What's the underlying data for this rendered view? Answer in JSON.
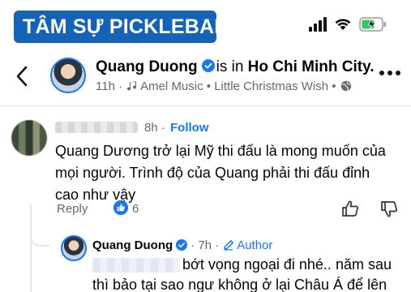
{
  "brand": {
    "logo_text": "TÂM SỰ PICKLEBALL"
  },
  "status_bar": {
    "signal_icon": "cellular-signal-icon",
    "wifi_icon": "wifi-icon",
    "battery_icon": "battery-charging-icon",
    "battery_color": "#34c759"
  },
  "post": {
    "author": "Quang Duong",
    "location_prefix": "is in",
    "location": "Ho Chi Minh City.",
    "time": "11h",
    "separator": "·",
    "music_artist": "Amel Music",
    "music_song": "Little Christmas Wish",
    "bullet": "•"
  },
  "comments": [
    {
      "time": "8h",
      "separator": "·",
      "follow_label": "Follow",
      "text": "Quang Dương trở lại Mỹ thi đấu là mong muốn của mọi người. Trình độ của Quang phải thi đấu đỉnh cao như vậy",
      "reply_label": "Reply",
      "reaction_count": "6"
    }
  ],
  "reply": {
    "author": "Quang Duong",
    "time": "7h",
    "separator": "·",
    "author_badge": "Author",
    "text_line1": "bớt vọng ngoại đi nhé.. năm sau",
    "text_line2": "thì bảo tại sao ngư không ở lại Châu Á để lên"
  },
  "colors": {
    "accent": "#1877f2",
    "brand": "#1463b8",
    "muted_text": "#65676b"
  }
}
